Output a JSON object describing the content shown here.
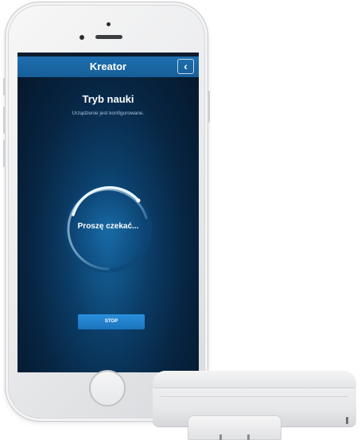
{
  "app": {
    "header": {
      "title": "Kreator",
      "back_button_symbol": "‹"
    },
    "learning_mode": {
      "title": "Tryb nauki",
      "subtitle": "Urządzenie jest konfigurowane."
    },
    "progress": {
      "status_text": "Proszę czekać..."
    },
    "actions": {
      "stop_label": "STOP"
    }
  },
  "colors": {
    "header_blue": "#1e6fb0",
    "button_blue": "#2a8fdc",
    "screen_dark": "#072441",
    "ring_highlight": "#cfefff"
  },
  "icons": {
    "back": "chevron-left-icon"
  }
}
